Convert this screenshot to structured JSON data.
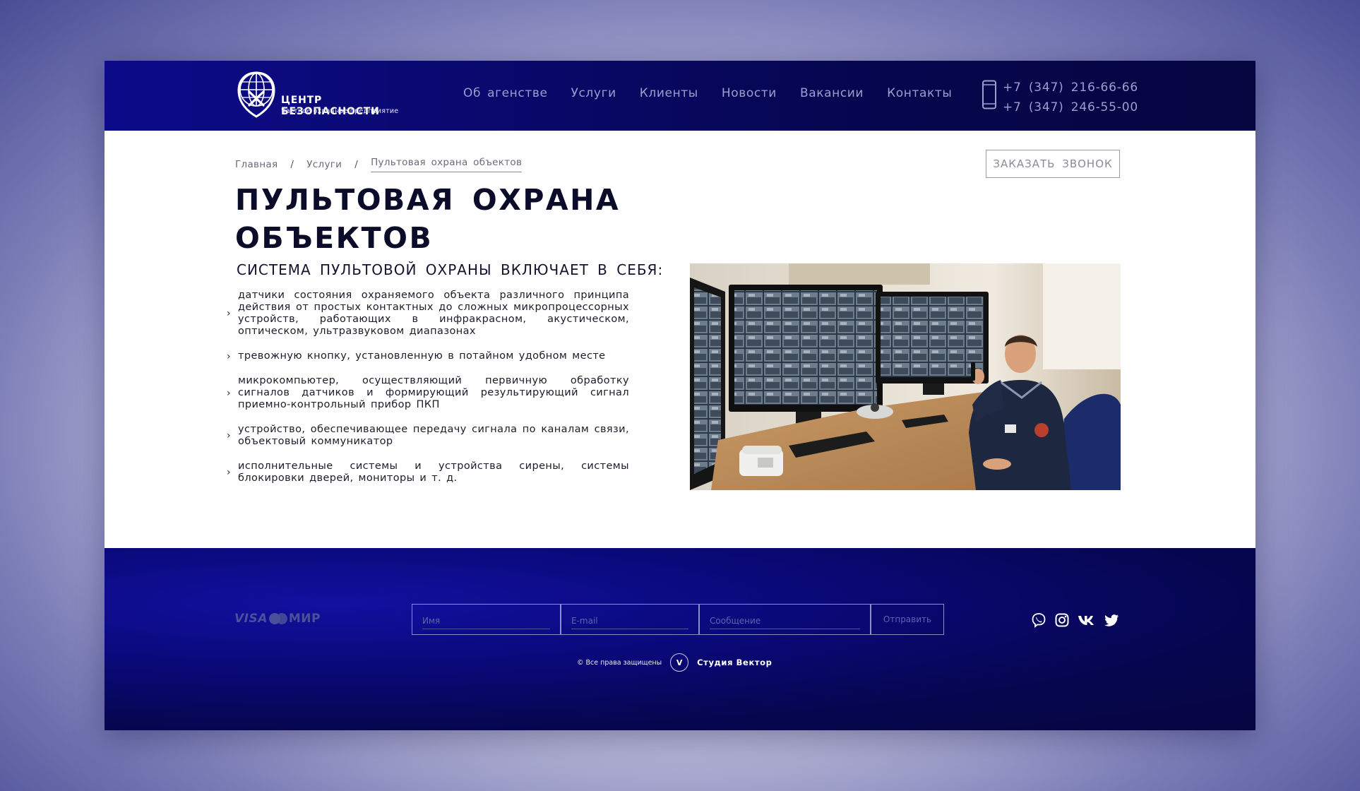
{
  "brand": {
    "name": "ЦЕНТР БЕЗОПАСНОСТИ",
    "tagline": "Частное охранное предприятие"
  },
  "nav": [
    {
      "label": "Об агенстве"
    },
    {
      "label": "Услуги"
    },
    {
      "label": "Клиенты"
    },
    {
      "label": "Новости"
    },
    {
      "label": "Вакансии"
    },
    {
      "label": "Контакты"
    }
  ],
  "contacts": {
    "phone1": "+7 (347) 216-66-66",
    "phone2": "+7 (347) 246-55-00"
  },
  "breadcrumb": [
    {
      "label": "Главная"
    },
    {
      "label": "Услуги"
    },
    {
      "label": "Пультовая охрана объектов"
    }
  ],
  "breadcrumb_separator": "/",
  "callback_button": "ЗАКАЗАТЬ ЗВОНОК",
  "page": {
    "title": "ПУЛЬТОВАЯ ОХРАНА ОБЪЕКТОВ",
    "section_title": "СИСТЕМА ПУЛЬТОВОЙ ОХРАНЫ ВКЛЮЧАЕТ В СЕБЯ:",
    "features": [
      "датчики состояния охраняемого объекта различного принципа действия от простых контактных до сложных микропроцессорных устройств, работающих в инфракрасном, акустическом, оптическом, ультразвуковом диапазонах",
      "тревожную кнопку, установленную в потайном удобном месте",
      "микрокомпьютер, осуществляющий первичную обработку сигналов датчиков и формирующий результирующий сигнал приемно-контрольный прибор ПКП",
      "устройство, обеспечивающее передачу сигнала по каналам связи, объектовый коммуникатор",
      "исполнительные системы и устройства сирены, системы блокировки дверей, мониторы и т. д."
    ]
  },
  "footer": {
    "payments": {
      "visa": "VISA",
      "mir": "МИР"
    },
    "form": {
      "name_placeholder": "Имя",
      "email_placeholder": "E-mail",
      "message_placeholder": "Сообщение",
      "submit_label": "Отправить"
    },
    "socials": [
      "viber-icon",
      "instagram-icon",
      "vk-icon",
      "twitter-icon"
    ],
    "copyright": "© Все права защищены",
    "studio_badge": "V",
    "studio_name": "Студия Вектор"
  },
  "colors": {
    "header_bg": "#0a0970",
    "footer_bg": "#060650",
    "nav_text": "#9a9fce",
    "title_text": "#0b0b2a"
  }
}
